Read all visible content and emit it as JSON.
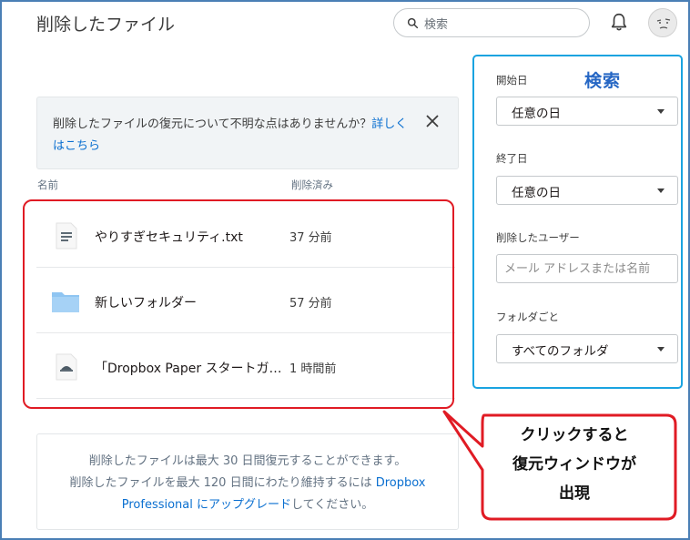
{
  "header": {
    "title": "削除したファイル",
    "search_placeholder": "検索"
  },
  "notice": {
    "text": "削除したファイルの復元について不明な点はありませんか？",
    "link": "詳しくはこちら"
  },
  "table": {
    "columns": [
      "名前",
      "削除済み"
    ],
    "rows": [
      {
        "name": "やりすぎセキュリティ.txt",
        "deleted": "37 分前",
        "icon": "text-file-icon"
      },
      {
        "name": "新しいフォルダー",
        "deleted": "57 分前",
        "icon": "folder-icon"
      },
      {
        "name": "「Dropbox Paper スタートガイド」",
        "deleted": "1 時間前",
        "icon": "paper-doc-icon"
      }
    ]
  },
  "info": {
    "line1": "削除したファイルは最大 30 日間復元することができます。",
    "line2_text": "削除したファイルを最大 120 日間にわたり維持するには ",
    "line2_link": "Dropbox",
    "line3_link": "Professional にアップグレード",
    "line3_text": "してください。"
  },
  "sidebar": {
    "title": "検索",
    "start_label": "開始日",
    "start_value": "任意の日",
    "end_label": "終了日",
    "end_value": "任意の日",
    "user_label": "削除したユーザー",
    "user_placeholder": "メール アドレスまたは名前",
    "folder_label": "フォルダごと",
    "folder_value": "すべてのフォルダ"
  },
  "callout": {
    "line1": "クリックすると",
    "line2": "復元ウィンドウが",
    "line3": "出現"
  },
  "colors": {
    "link": "#0a6fd0",
    "annotation_red": "#e01b24",
    "annotation_blue": "#1aa3e0",
    "folder": "#8fc5f2"
  }
}
